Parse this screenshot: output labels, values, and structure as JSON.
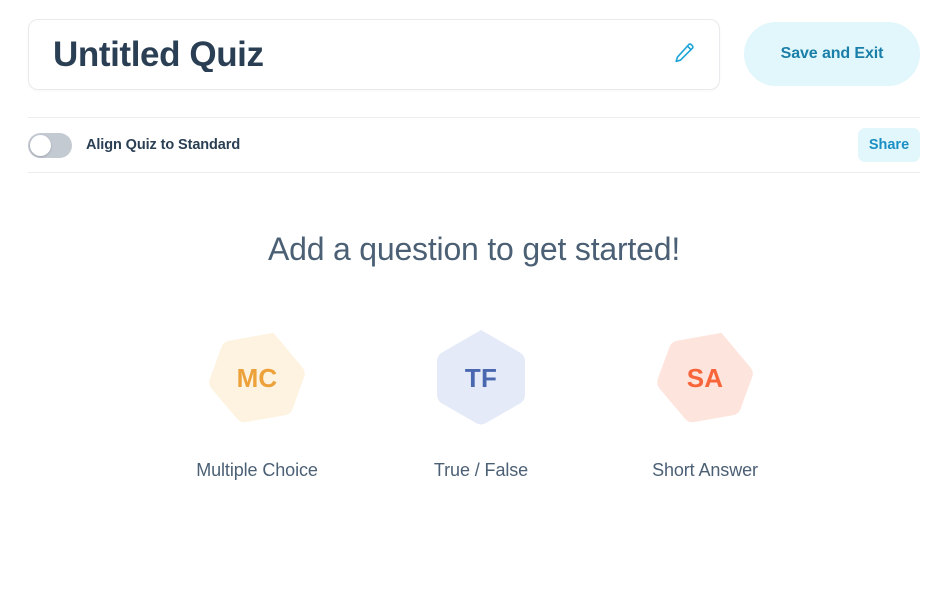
{
  "header": {
    "quiz_title": "Untitled Quiz",
    "edit_icon": "pencil-icon",
    "save_exit_label": "Save and Exit"
  },
  "settings_bar": {
    "align_toggle_label": "Align Quiz to Standard",
    "align_toggle_state": "off",
    "share_label": "Share"
  },
  "empty_state": {
    "heading": "Add a question to get started!",
    "question_types": [
      {
        "abbr": "MC",
        "label": "Multiple Choice",
        "fill": "#FDF3E0",
        "text_color": "#EDA13B",
        "rotation": 20
      },
      {
        "abbr": "TF",
        "label": "True / False",
        "fill": "#E4EAF7",
        "text_color": "#4A68B0",
        "rotation": 0
      },
      {
        "abbr": "SA",
        "label": "Short Answer",
        "fill": "#FDE4DC",
        "text_color": "#F9653A",
        "rotation": 20
      }
    ]
  },
  "colors": {
    "accent_cyan": "#E2F7FC",
    "accent_cyan_text": "#1A7FA8",
    "title_text": "#2A3F54",
    "body_text": "#4C6075",
    "divider": "#EBEDF0",
    "toggle_off": "#C4CAD2"
  }
}
